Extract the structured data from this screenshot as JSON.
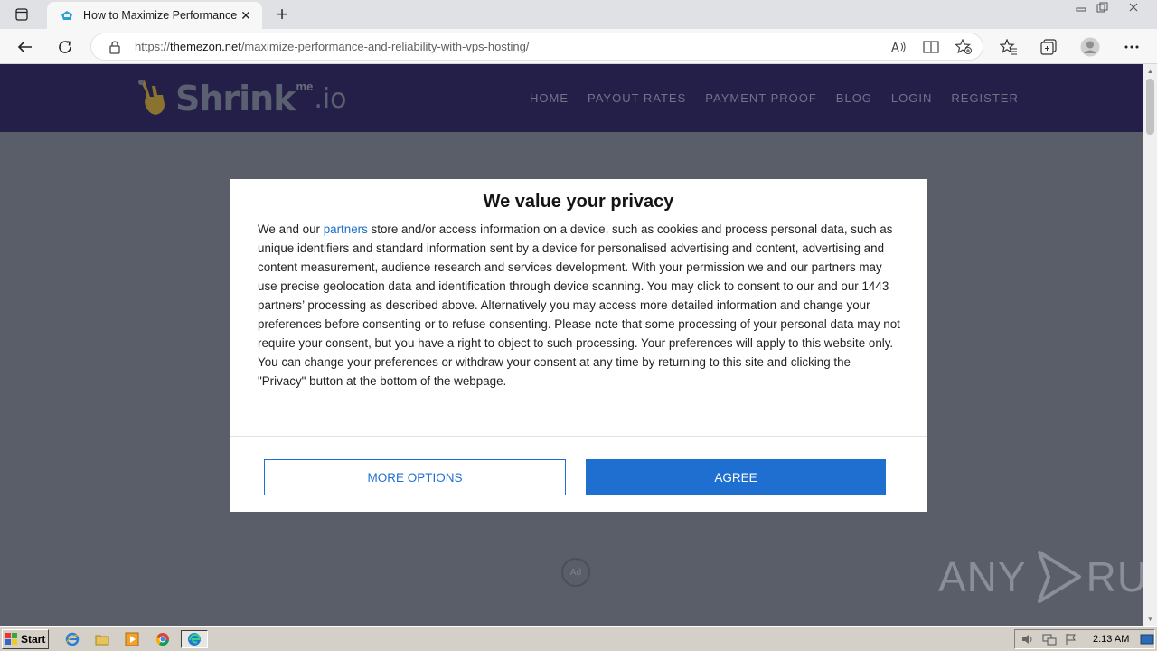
{
  "browser": {
    "tab_title": "How to Maximize Performance",
    "url_scheme": "https://",
    "url_host": "themezon.net",
    "url_path": "/maximize-performance-and-reliability-with-vps-hosting/"
  },
  "site": {
    "logo_main": "Shrink",
    "logo_me": "me",
    "logo_io": ".io",
    "nav": [
      "HOME",
      "PAYOUT RATES",
      "PAYMENT PROOF",
      "BLOG",
      "LOGIN",
      "REGISTER"
    ]
  },
  "consent": {
    "title": "We value your privacy",
    "body_prefix": "We and our ",
    "body_link": "partners",
    "body_suffix": " store and/or access information on a device, such as cookies and process personal data, such as unique identifiers and standard information sent by a device for personalised advertising and content, advertising and content measurement, audience research and services development. With your permission we and our partners may use precise geolocation data and identification through device scanning. You may click to consent to our and our 1443 partners’ processing as described above. Alternatively you may access more detailed information and change your preferences before consenting or to refuse consenting. Please note that some processing of your personal data may not require your consent, but you have a right to object to such processing. Your preferences will apply to this website only. You can change your preferences or withdraw your consent at any time by returning to this site and clicking the \"Privacy\" button at the bottom of the webpage.",
    "more_options_label": "MORE OPTIONS",
    "agree_label": "AGREE",
    "link_color": "#1a6fc9",
    "button_color": "#1f6fd1"
  },
  "ad_badge": "Ad",
  "watermark": {
    "left": "ANY",
    "right": "RUN"
  },
  "taskbar": {
    "start_label": "Start",
    "clock": "2:13 AM"
  }
}
